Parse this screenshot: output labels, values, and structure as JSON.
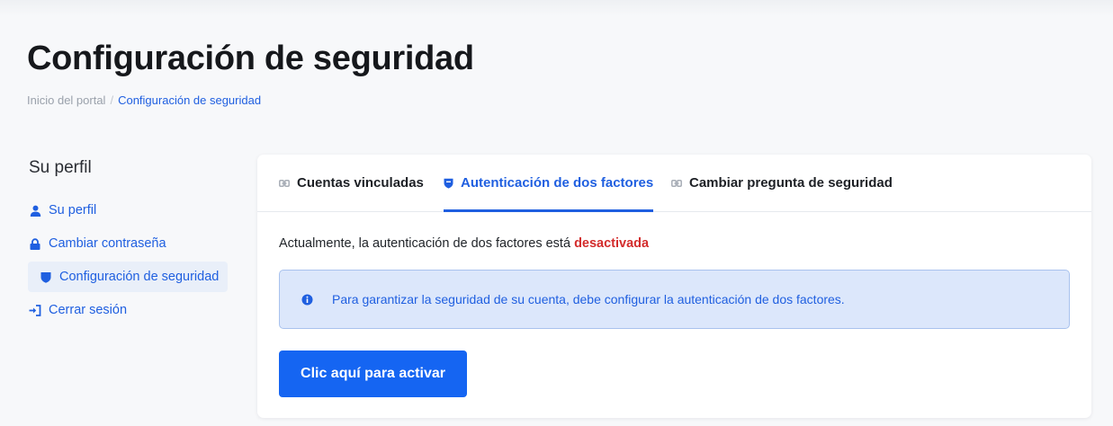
{
  "page": {
    "title": "Configuración de seguridad"
  },
  "breadcrumb": {
    "home": "Inicio del portal",
    "separator": "/",
    "current": "Configuración de seguridad"
  },
  "sidebar": {
    "title": "Su perfil",
    "items": [
      {
        "label": "Su perfil",
        "icon": "user-icon"
      },
      {
        "label": "Cambiar contraseña",
        "icon": "lock-icon"
      },
      {
        "label": "Configuración de seguridad",
        "icon": "shield-icon",
        "active": true
      },
      {
        "label": "Cerrar sesión",
        "icon": "sign-out-icon"
      }
    ]
  },
  "tabs": [
    {
      "label": "Cuentas vinculadas",
      "icon": "link-icon"
    },
    {
      "label": "Autenticación de dos factores",
      "icon": "shield-icon",
      "active": true
    },
    {
      "label": "Cambiar pregunta de seguridad",
      "icon": "link-icon"
    }
  ],
  "content": {
    "status_prefix": "Actualmente, la autenticación de dos factores está",
    "status_value": "desactivada",
    "alert_text": "Para garantizar la seguridad de su cuenta, debe configurar la autenticación de dos factores.",
    "alert_icon": "info-icon",
    "activate_label": "Clic aquí para activar"
  },
  "colors": {
    "accent": "#1565f2",
    "link": "#1f5fe0",
    "danger": "#d32c2c",
    "alert_bg": "#dce7fb"
  }
}
